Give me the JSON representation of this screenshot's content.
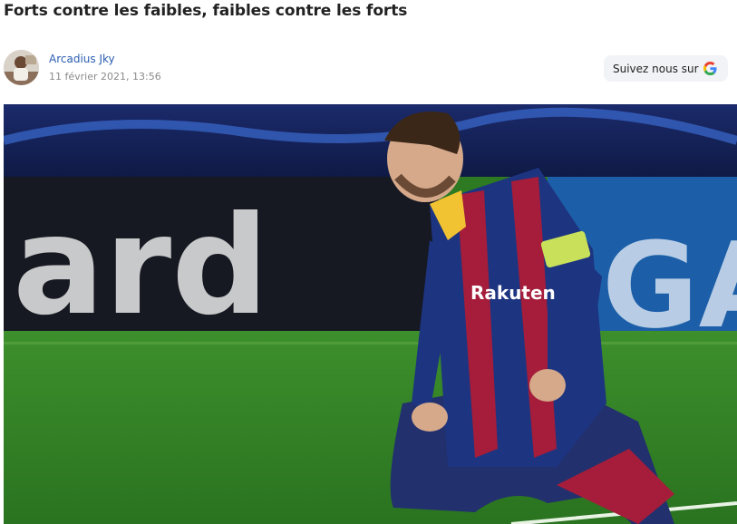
{
  "article": {
    "title": "Forts contre les faibles, faibles contre les forts"
  },
  "author": {
    "name": "Arcadius Jky",
    "date": "11 février 2021, 13:56",
    "avatar_icon": "user-avatar"
  },
  "follow": {
    "label": "Suivez nous sur",
    "icon": "google-icon"
  },
  "hero": {
    "icon": "football-player-kneeling-photo"
  },
  "colors": {
    "link": "#2a5db0",
    "muted": "#8a8a8a",
    "button_bg": "#f1f3f6"
  }
}
